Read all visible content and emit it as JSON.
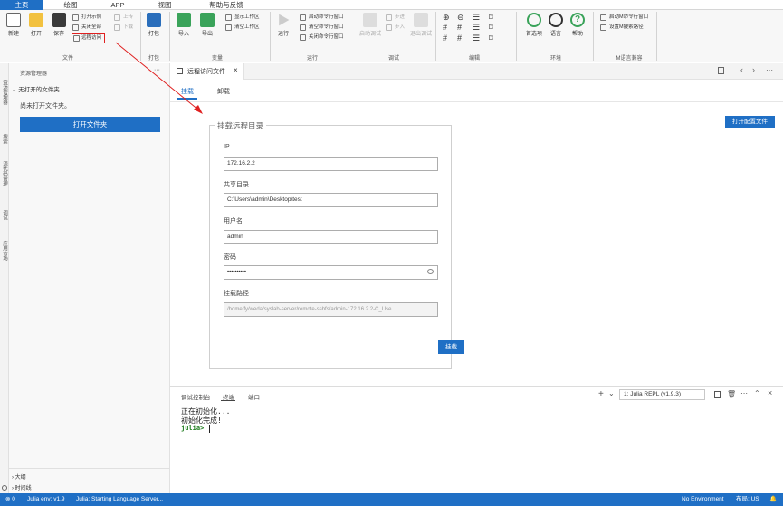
{
  "ribbon_tabs": [
    "主页",
    "绘图",
    "APP",
    "视图",
    "帮助与反馈"
  ],
  "file_group": {
    "new": "新建",
    "open": "打开",
    "save": "保存",
    "open_example": "打开示例",
    "close_all": "关闭全部",
    "remote_access": "远程访问",
    "upload": "上传",
    "download": "下载",
    "label": "文件"
  },
  "package_group": {
    "pack": "打包",
    "label": "打包"
  },
  "variable_group": {
    "import": "导入",
    "export": "导出",
    "show_ws": "显示工作区",
    "clear_ws": "清空工作区",
    "label": "变量"
  },
  "run_group": {
    "run": "运行",
    "start_cmd": "启动命令行窗口",
    "clear_cmd": "清空命令行窗口",
    "close_cmd": "关闭命令行窗口",
    "label": "运行"
  },
  "debug_group": {
    "start_debug": "启动调试",
    "step_over": "步进",
    "step_into": "步入",
    "step_out": "退出调试",
    "label": "调试"
  },
  "edit_group": {
    "label": "编辑"
  },
  "env_group": {
    "preferences": "首选项",
    "language": "语言",
    "help": "帮助",
    "label": "环境"
  },
  "m_group": {
    "start_m_cmd": "启动M命令行窗口",
    "set_m_path": "设置M搜索路径",
    "label": "M语言兼容"
  },
  "sidebar": {
    "title": "资源管理器",
    "more": "···",
    "section": "无打开的文件夹",
    "empty_msg": "尚未打开文件夹。",
    "open_folder": "打开文件夹",
    "outline": "大纲",
    "timeline": "时间线"
  },
  "activity": [
    "资源管理器",
    "搜索",
    "源代码管理",
    "调试",
    "应用市场"
  ],
  "editor_tab": {
    "title": "远程访问文件",
    "close": "×"
  },
  "subtabs": {
    "mount": "挂载",
    "unmount": "卸载"
  },
  "open_config": "打开配置文件",
  "form": {
    "legend": "挂载远程目录",
    "ip_label": "IP",
    "ip_value": "172.16.2.2",
    "share_label": "共享目录",
    "share_value": "C:\\Users\\admin\\Desktop\\test",
    "user_label": "用户名",
    "user_value": "admin",
    "pwd_label": "密码",
    "pwd_value": "••••••••••",
    "mount_path_label": "挂载路径",
    "mount_path_value": "/home/fy/weda/syslab-server/remote-sshfs/admin-172.16.2.2-C_Use",
    "mount_button": "挂载"
  },
  "panel_tabs": [
    "调试控制台",
    "终端",
    "端口"
  ],
  "repl": {
    "select": "1: Julia REPL (v1.9.3)",
    "line1": "正在初始化...",
    "line2": "初始化完成!",
    "prompt": "julia> "
  },
  "status": {
    "left1": "0",
    "left2": "Julia env: v1.9",
    "left3": "Julia: Starting Language Server...",
    "right1": "No Environment",
    "right2": "布局: US"
  },
  "accent": "#1f6fc5",
  "highlight": "#e02020"
}
